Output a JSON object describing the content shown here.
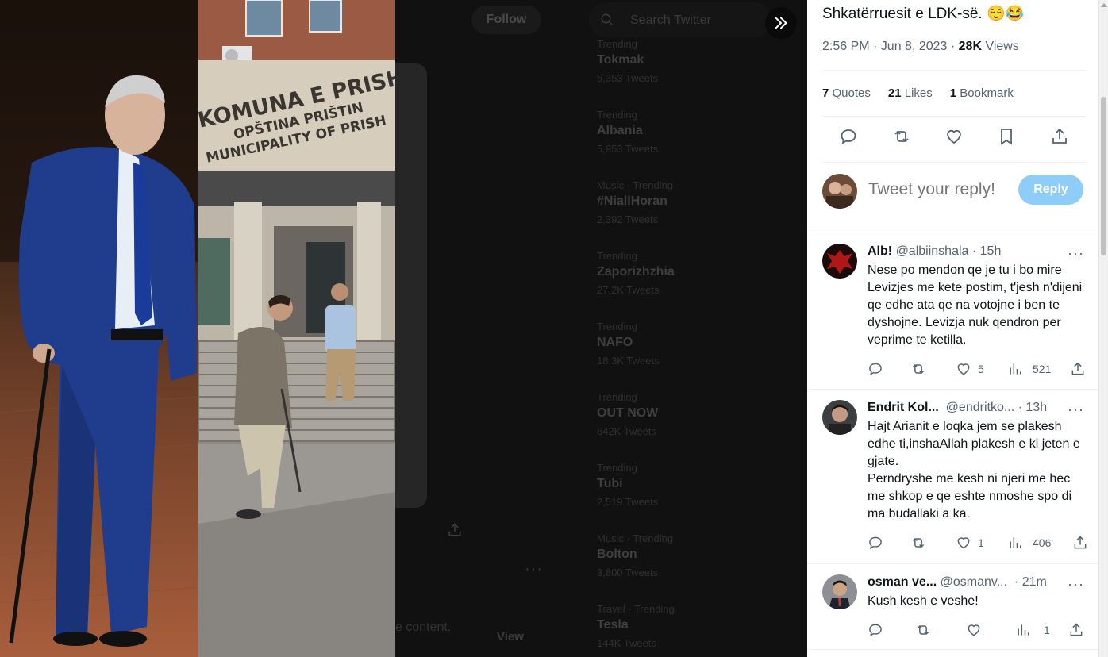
{
  "background": {
    "follow_label": "Follow",
    "search_placeholder": "Search Twitter",
    "view_label": "View",
    "content_snippet": "e content.",
    "trends": [
      {
        "category": "Trending",
        "name": "Tokmak",
        "count": "5,353 Tweets"
      },
      {
        "category": "Trending",
        "name": "Albania",
        "count": "5,953 Tweets"
      },
      {
        "category": "Music · Trending",
        "name": "#NiallHoran",
        "count": "2,392 Tweets"
      },
      {
        "category": "Trending",
        "name": "Zaporizhzhia",
        "count": "27.2K Tweets"
      },
      {
        "category": "Trending",
        "name": "NAFO",
        "count": "18.3K Tweets"
      },
      {
        "category": "Trending",
        "name": "OUT NOW",
        "count": "642K Tweets"
      },
      {
        "category": "Trending",
        "name": "Tubi",
        "count": "2,519 Tweets"
      },
      {
        "category": "Music · Trending",
        "name": "Bolton",
        "count": "3,800 Tweets"
      },
      {
        "category": "Travel · Trending",
        "name": "Tesla",
        "count": "144K Tweets"
      }
    ]
  },
  "photo": {
    "building_sign_line1": "KOMUNA E PRISHT",
    "building_sign_line2": "OPŠTINA PRIŠTIN",
    "building_sign_line3": "MUNICIPALITY OF PRISH"
  },
  "tweet": {
    "text": "Shkatërruesit e LDK-së. 😌😂",
    "time": "2:56 PM · Jun 8, 2023",
    "separator": " · ",
    "views_count": "28K",
    "views_label": "Views",
    "stats": {
      "quotes_count": "7",
      "quotes_label": "Quotes",
      "likes_count": "21",
      "likes_label": "Likes",
      "bookmarks_count": "1",
      "bookmarks_label": "Bookmark"
    }
  },
  "composer": {
    "placeholder": "Tweet your reply!",
    "reply_label": "Reply"
  },
  "replies": [
    {
      "name": "Alb!",
      "handle": "@albiinshala",
      "time": "· 15h",
      "text": "Nese po mendon qe je tu i bo mire Levizjes me kete postim, t'jesh n'dijeni qe edhe ata qe na votojne i ben te dyshojne. Levizja nuk qendron per veprime te ketilla.",
      "likes": "5",
      "views": "521"
    },
    {
      "name": "Endrit Kol...",
      "handle": "@endritko...",
      "time": "· 13h",
      "text": "Hajt Arianit e loqka jem se plakesh edhe ti,inshaAllah plakesh e ki jeten e gjate.\nPerndryshe me kesh ni njeri me hec me shkop e qe eshte nmoshe spo di ma budallaki a ka.",
      "likes": "1",
      "views": "406"
    },
    {
      "name": "osman ve...",
      "handle": "@osmanv...",
      "time": "· 21m",
      "text": "Kush kesh e veshe!",
      "likes": "",
      "views": "1"
    }
  ],
  "colors": {
    "accent_disabled": "#8ecdf8",
    "text_primary": "#0f1419",
    "text_secondary": "#536471"
  },
  "icons": [
    "collapse-icon",
    "search-icon",
    "reply-icon",
    "retweet-icon",
    "like-icon",
    "bookmark-icon",
    "share-icon",
    "views-icon",
    "more-icon"
  ]
}
